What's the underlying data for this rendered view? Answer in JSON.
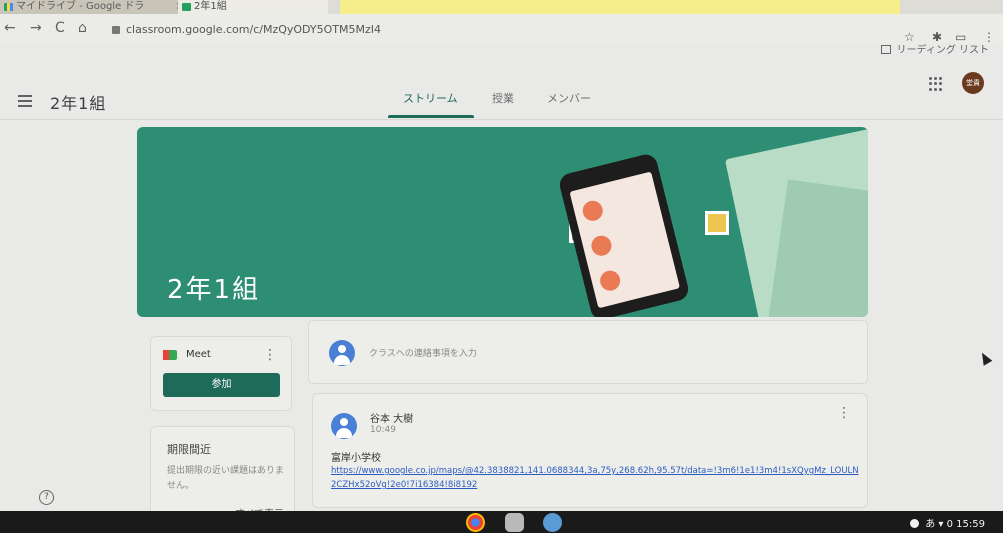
{
  "browser": {
    "tabs": [
      {
        "title": "マイドライブ - Google ドラ",
        "close": "×"
      },
      {
        "title": "2年1組"
      }
    ],
    "url": "classroom.google.com/c/MzQyODY5OTM5MzI4",
    "reading_list": "リーディング リスト"
  },
  "header": {
    "class_name": "2年1組",
    "tabs": [
      "ストリーム",
      "授業",
      "メンバー"
    ],
    "active_tab": "ストリーム",
    "avatar_text": "堂貴"
  },
  "banner": {
    "title": "2年1組",
    "color": "#2e8e73"
  },
  "meet": {
    "label": "Meet",
    "join_label": "参加"
  },
  "upcoming": {
    "title": "期限間近",
    "empty_text": "提出期限の近い課題はありません。",
    "view_all": "すべて表示"
  },
  "announce": {
    "placeholder": "クラスへの連絡事項を入力"
  },
  "post": {
    "author": "谷本 大樹",
    "time": "10:49",
    "text": "富岸小学校",
    "link": "https://www.google.co.jp/maps/@42.3838821,141.0688344,3a,75y,268.62h,95.57t/data=!3m6!1e1!3m4!1sXQygMz_LOULN2CZHx52oVg!2e0!7i16384!8i8192"
  },
  "help_label": "?",
  "system": {
    "ime": "あ",
    "battery": "0",
    "clock": "15:59"
  },
  "colors": {
    "accent": "#1e6b5a",
    "link": "#2b5cc2"
  }
}
